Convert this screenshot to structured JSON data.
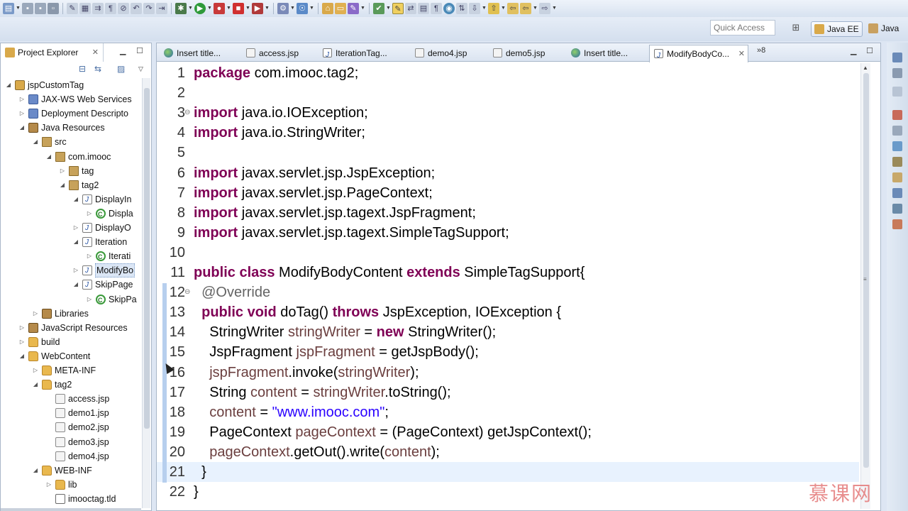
{
  "toolbar": {
    "quick_access_placeholder": "Quick Access",
    "perspectives": [
      {
        "label": "Java EE",
        "active": true
      },
      {
        "label": "Java",
        "active": false
      }
    ]
  },
  "project_explorer": {
    "title": "Project Explorer",
    "close_glyph": "✕",
    "tree": [
      {
        "label": "jspCustomTag",
        "icon": "project-icon",
        "depth": 0,
        "expanded": true
      },
      {
        "label": "JAX-WS Web Services",
        "icon": "service-icon",
        "depth": 1,
        "expanded": false
      },
      {
        "label": "Deployment Descripto",
        "icon": "descriptor-icon",
        "depth": 1,
        "expanded": false
      },
      {
        "label": "Java Resources",
        "icon": "resources-icon",
        "depth": 1,
        "expanded": true
      },
      {
        "label": "src",
        "icon": "source-folder-icon",
        "depth": 2,
        "expanded": true
      },
      {
        "label": "com.imooc",
        "icon": "package-icon",
        "depth": 3,
        "expanded": true
      },
      {
        "label": "tag",
        "icon": "package-icon",
        "depth": 4,
        "expanded": false
      },
      {
        "label": "tag2",
        "icon": "package-icon",
        "depth": 4,
        "expanded": true
      },
      {
        "label": "DisplayIn",
        "icon": "java-file-icon",
        "depth": 5,
        "expanded": true
      },
      {
        "label": "Displa",
        "icon": "class-icon",
        "depth": 6,
        "expanded": false
      },
      {
        "label": "DisplayO",
        "icon": "java-file-icon",
        "depth": 5,
        "expanded": false
      },
      {
        "label": "Iteration",
        "icon": "java-file-icon",
        "depth": 5,
        "expanded": true
      },
      {
        "label": "Iterati",
        "icon": "class-icon",
        "depth": 6,
        "expanded": false
      },
      {
        "label": "ModifyBo",
        "icon": "java-file-icon",
        "depth": 5,
        "expanded": false,
        "selected": true
      },
      {
        "label": "SkipPage",
        "icon": "java-file-icon",
        "depth": 5,
        "expanded": true
      },
      {
        "label": "SkipPa",
        "icon": "class-icon",
        "depth": 6,
        "expanded": false
      },
      {
        "label": "Libraries",
        "icon": "library-icon",
        "depth": 2,
        "expanded": false
      },
      {
        "label": "JavaScript Resources",
        "icon": "resources-icon",
        "depth": 1,
        "expanded": false
      },
      {
        "label": "build",
        "icon": "folder-icon",
        "depth": 1,
        "expanded": false
      },
      {
        "label": "WebContent",
        "icon": "folder-icon",
        "depth": 1,
        "expanded": true
      },
      {
        "label": "META-INF",
        "icon": "folder-icon",
        "depth": 2,
        "expanded": false
      },
      {
        "label": "tag2",
        "icon": "folder-icon",
        "depth": 2,
        "expanded": true
      },
      {
        "label": "access.jsp",
        "icon": "jsp-file-icon",
        "depth": 3,
        "leaf": true
      },
      {
        "label": "demo1.jsp",
        "icon": "jsp-file-icon",
        "depth": 3,
        "leaf": true
      },
      {
        "label": "demo2.jsp",
        "icon": "jsp-file-icon",
        "depth": 3,
        "leaf": true
      },
      {
        "label": "demo3.jsp",
        "icon": "jsp-file-icon",
        "depth": 3,
        "leaf": true
      },
      {
        "label": "demo4.jsp",
        "icon": "jsp-file-icon",
        "depth": 3,
        "leaf": true
      },
      {
        "label": "WEB-INF",
        "icon": "folder-icon",
        "depth": 2,
        "expanded": true
      },
      {
        "label": "lib",
        "icon": "folder-icon",
        "depth": 3,
        "expanded": false
      },
      {
        "label": "imooctag.tld",
        "icon": "tld-file-icon",
        "depth": 3,
        "leaf": true
      }
    ]
  },
  "editor": {
    "tabs": [
      {
        "label": "Insert title...",
        "icon": "globe-icon"
      },
      {
        "label": "access.jsp",
        "icon": "jsp-file-icon"
      },
      {
        "label": "IterationTag...",
        "icon": "java-file-icon"
      },
      {
        "label": "demo4.jsp",
        "icon": "jsp-file-icon"
      },
      {
        "label": "demo5.jsp",
        "icon": "jsp-file-icon"
      },
      {
        "label": "Insert title...",
        "icon": "globe-icon"
      },
      {
        "label": "ModifyBodyCo...",
        "icon": "java-file-icon",
        "active": true
      }
    ],
    "more_tabs": "»8",
    "current_line": 21,
    "lines": [
      {
        "n": "1",
        "fold": "",
        "t": [
          [
            "k",
            "package"
          ],
          [
            "p",
            " com.imooc.tag2;"
          ]
        ]
      },
      {
        "n": "2",
        "fold": "",
        "t": []
      },
      {
        "n": "3",
        "fold": "⊖",
        "t": [
          [
            "k",
            "import"
          ],
          [
            "p",
            " java.io.IOException;"
          ]
        ]
      },
      {
        "n": "4",
        "fold": "",
        "t": [
          [
            "k",
            "import"
          ],
          [
            "p",
            " java.io.StringWriter;"
          ]
        ]
      },
      {
        "n": "5",
        "fold": "",
        "t": []
      },
      {
        "n": "6",
        "fold": "",
        "t": [
          [
            "k",
            "import"
          ],
          [
            "p",
            " javax.servlet.jsp.JspException;"
          ]
        ]
      },
      {
        "n": "7",
        "fold": "",
        "t": [
          [
            "k",
            "import"
          ],
          [
            "p",
            " javax.servlet.jsp.PageContext;"
          ]
        ]
      },
      {
        "n": "8",
        "fold": "",
        "t": [
          [
            "k",
            "import"
          ],
          [
            "p",
            " javax.servlet.jsp.tagext.JspFragment;"
          ]
        ]
      },
      {
        "n": "9",
        "fold": "",
        "t": [
          [
            "k",
            "import"
          ],
          [
            "p",
            " javax.servlet.jsp.tagext.SimpleTagSupport;"
          ]
        ]
      },
      {
        "n": "10",
        "fold": "",
        "t": []
      },
      {
        "n": "11",
        "fold": "",
        "t": [
          [
            "k",
            "public class"
          ],
          [
            "p",
            " ModifyBodyContent "
          ],
          [
            "k",
            "extends"
          ],
          [
            "p",
            " SimpleTagSupport{"
          ]
        ]
      },
      {
        "n": "12",
        "fold": "⊖",
        "t": [
          [
            "p",
            "  "
          ],
          [
            "a",
            "@Override"
          ]
        ]
      },
      {
        "n": "13",
        "fold": "",
        "t": [
          [
            "p",
            "  "
          ],
          [
            "k",
            "public void"
          ],
          [
            "p",
            " doTag() "
          ],
          [
            "k",
            "throws"
          ],
          [
            "p",
            " JspException, IOException {"
          ]
        ]
      },
      {
        "n": "14",
        "fold": "",
        "t": [
          [
            "p",
            "    StringWriter "
          ],
          [
            "v",
            "stringWriter"
          ],
          [
            "p",
            " = "
          ],
          [
            "k",
            "new"
          ],
          [
            "p",
            " StringWriter();"
          ]
        ]
      },
      {
        "n": "15",
        "fold": "",
        "t": [
          [
            "p",
            "    JspFragment "
          ],
          [
            "v",
            "jspFragment"
          ],
          [
            "p",
            " = getJspBody();"
          ]
        ]
      },
      {
        "n": "16",
        "fold": "",
        "t": [
          [
            "p",
            "    "
          ],
          [
            "v",
            "jspFragment"
          ],
          [
            "p",
            ".invoke("
          ],
          [
            "v",
            "stringWriter"
          ],
          [
            "p",
            ");"
          ]
        ]
      },
      {
        "n": "17",
        "fold": "",
        "t": [
          [
            "p",
            "    String "
          ],
          [
            "v",
            "content"
          ],
          [
            "p",
            " = "
          ],
          [
            "v",
            "stringWriter"
          ],
          [
            "p",
            ".toString();"
          ]
        ]
      },
      {
        "n": "18",
        "fold": "",
        "t": [
          [
            "p",
            "    "
          ],
          [
            "v",
            "content"
          ],
          [
            "p",
            " = "
          ],
          [
            "s",
            "\"www.imooc.com\""
          ],
          [
            "p",
            ";"
          ]
        ]
      },
      {
        "n": "19",
        "fold": "",
        "t": [
          [
            "p",
            "    PageContext "
          ],
          [
            "v",
            "pageContext"
          ],
          [
            "p",
            " = (PageContext) getJspContext();"
          ]
        ]
      },
      {
        "n": "20",
        "fold": "",
        "t": [
          [
            "p",
            "    "
          ],
          [
            "v",
            "pageContext"
          ],
          [
            "p",
            ".getOut().write("
          ],
          [
            "v",
            "content"
          ],
          [
            "p",
            ");"
          ]
        ]
      },
      {
        "n": "21",
        "fold": "",
        "t": [
          [
            "p",
            "  }"
          ]
        ]
      },
      {
        "n": "22",
        "fold": "",
        "t": [
          [
            "p",
            "}"
          ]
        ]
      }
    ]
  },
  "watermark": "慕课网",
  "colors": {
    "keyword": "#7f0055",
    "annotation": "#646464",
    "variable": "#6a3e3e",
    "string": "#2a00ff",
    "current_line": "#e8f2fe",
    "selection_frame": "#7a9cc8"
  }
}
